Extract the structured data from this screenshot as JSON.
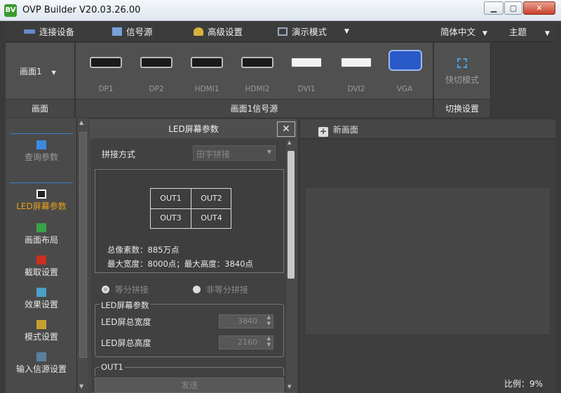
{
  "window": {
    "title": "OVP Builder  V20.03.26.00",
    "logo": "BV"
  },
  "menu": {
    "connect": "连接设备",
    "signal": "信号源",
    "advanced": "高级设置",
    "demo": "演示模式",
    "language": "简体中文",
    "theme": "主题"
  },
  "ribbon": {
    "screen_select": "画面1",
    "screen_group_label": "画面",
    "signal_group_label": "画面1信号源",
    "ports": [
      "DP1",
      "DP2",
      "HDMI1",
      "HDMI2",
      "DVI1",
      "DVI2",
      "VGA"
    ],
    "quickswitch_label": "快切模式",
    "switch_group_label": "切换设置"
  },
  "sidebar": {
    "items": [
      {
        "label": "查询参数",
        "icon": "search-icon"
      },
      {
        "label": "LED屏幕参数",
        "icon": "monitor-icon",
        "active": true
      },
      {
        "label": "画面布局",
        "icon": "layers-icon"
      },
      {
        "label": "截取设置",
        "icon": "crop-icon"
      },
      {
        "label": "效果设置",
        "icon": "image-icon"
      },
      {
        "label": "模式设置",
        "icon": "mode-icon"
      },
      {
        "label": "输入信源设置",
        "icon": "input-icon"
      }
    ]
  },
  "dialog": {
    "title": "LED屏幕参数",
    "splice_label": "拼接方式",
    "splice_value": "田字拼接",
    "outputs": [
      "OUT1",
      "OUT2",
      "OUT3",
      "OUT4"
    ],
    "total_pixels": "总像素数：885万点",
    "max_dims": "最大宽度：8000点；最大高度：3840点",
    "radio_equal": "等分拼接",
    "radio_unequal": "非等分拼接",
    "led_group": "LED屏幕参数",
    "total_width_label": "LED屏总宽度",
    "total_width_value": "3840",
    "total_height_label": "LED屏总高度",
    "total_height_value": "2160",
    "out1_group": "OUT1",
    "send_button": "发送"
  },
  "canvas": {
    "new_screen": "新画面",
    "scale": "比例：9%"
  },
  "colors": {
    "accent": "#e8a21a",
    "bg": "#3a3a3a",
    "panel": "#505050"
  }
}
